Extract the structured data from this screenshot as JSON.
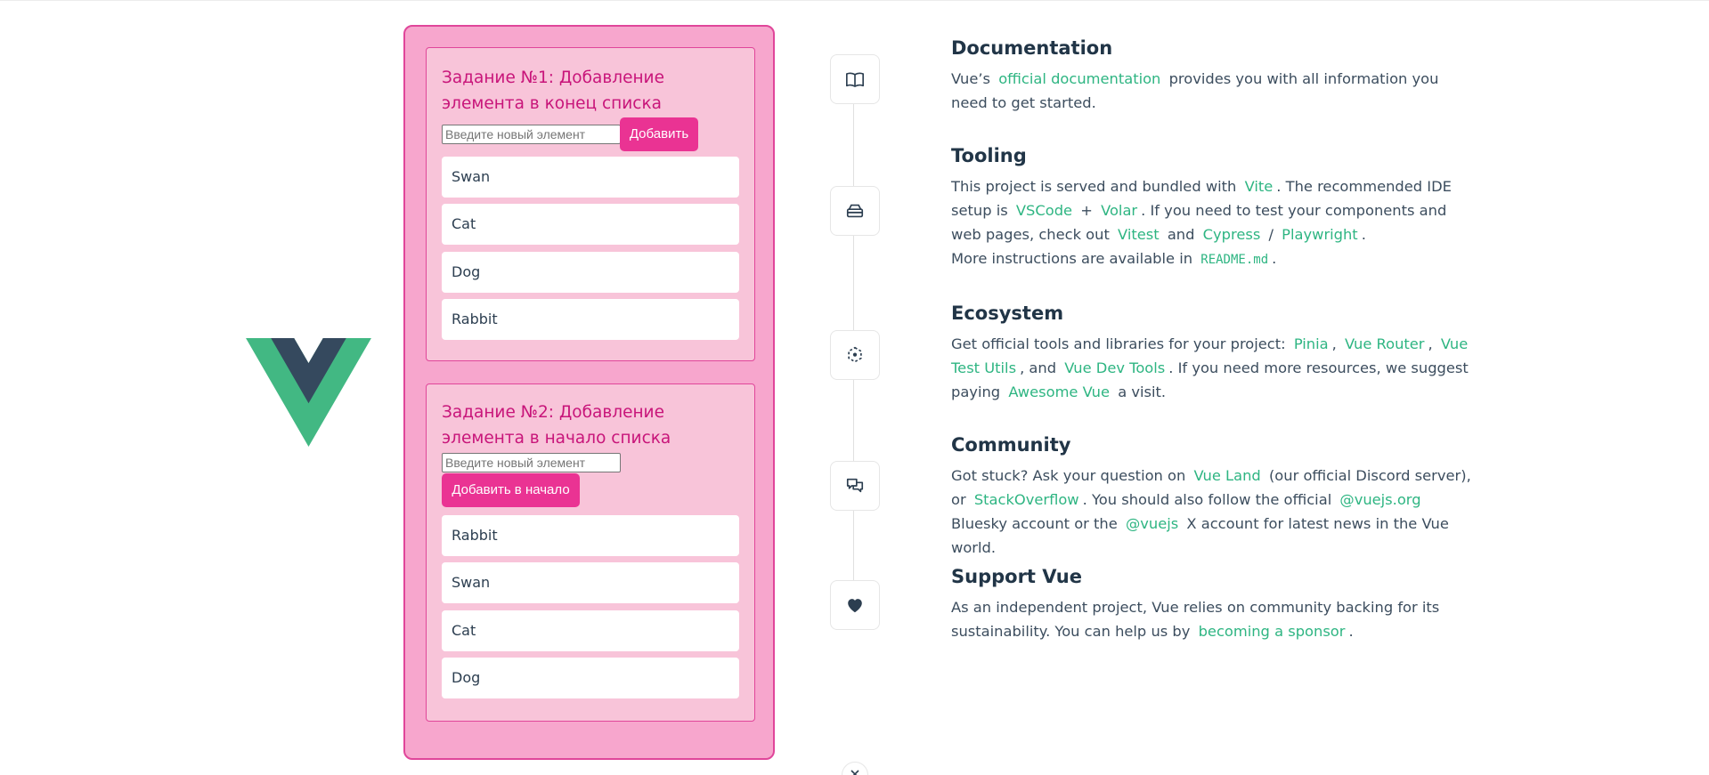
{
  "colors": {
    "vue_green": "#42b883",
    "vue_dark": "#35495e",
    "panel_bg": "#f7a6cd",
    "panel_border": "#e0469a",
    "task_bg": "#f8c4d9",
    "button_pink": "#ea3393",
    "title_pink": "#c8157a",
    "link_green": "#2eb582"
  },
  "logo": {
    "icon": "vue-logo-icon"
  },
  "task1": {
    "title": "Задание №1: Добавление элемента в конец списка",
    "input_placeholder": "Введите новый элемент",
    "input_value": "",
    "button_label": "Добавить",
    "items": [
      "Swan",
      "Cat",
      "Dog",
      "Rabbit"
    ]
  },
  "task2": {
    "title": "Задание №2: Добавление элемента в начало списка",
    "input_placeholder": "Введите новый элемент",
    "input_value": "",
    "button_label": "Добавить в начало",
    "items": [
      "Rabbit",
      "Swan",
      "Cat",
      "Dog"
    ]
  },
  "timeline_icons": [
    "documentation-icon",
    "tooling-icon",
    "ecosystem-icon",
    "community-icon",
    "support-icon"
  ],
  "documentation": {
    "title": "Documentation",
    "t1": "Vue’s",
    "link1": "official documentation",
    "t2": "provides you with all information you need to get started."
  },
  "tooling": {
    "title": "Tooling",
    "t1": "This project is served and bundled with",
    "link_vite": "Vite",
    "t2": ". The recommended IDE setup is",
    "link_vscode": "VSCode",
    "t3": "+",
    "link_volar": "Volar",
    "t4": ". If you need to test your components and web pages, check out",
    "link_vitest": "Vitest",
    "t5": "and",
    "link_cypress": "Cypress",
    "t6": "/",
    "link_playwright": "Playwright",
    "t7": ".",
    "t8": "More instructions are available in",
    "code_readme": "README.md",
    "t9": "."
  },
  "ecosystem": {
    "title": "Ecosystem",
    "t1": "Get official tools and libraries for your project:",
    "link_pinia": "Pinia",
    "t2": ",",
    "link_router": "Vue Router",
    "t3": ",",
    "link_test_utils": "Vue Test Utils",
    "t4": ", and",
    "link_devtools": "Vue Dev Tools",
    "t5": ". If you need more resources, we suggest paying",
    "link_awesome": "Awesome Vue",
    "t6": "a visit."
  },
  "community": {
    "title": "Community",
    "t1": "Got stuck? Ask your question on",
    "link_vue_land": "Vue Land",
    "t2": "(our official Discord server), or",
    "link_stackoverflow": "StackOverflow",
    "t3": ". You should also follow the official",
    "link_bluesky": "@vuejs.org",
    "t4": "Bluesky account or the",
    "link_x": "@vuejs",
    "t5": "X account for latest news in the Vue world."
  },
  "support": {
    "title": "Support Vue",
    "t1": "As an independent project, Vue relies on community backing for its sustainability. You can help us by",
    "link_sponsor": "becoming a sponsor",
    "t2": "."
  }
}
